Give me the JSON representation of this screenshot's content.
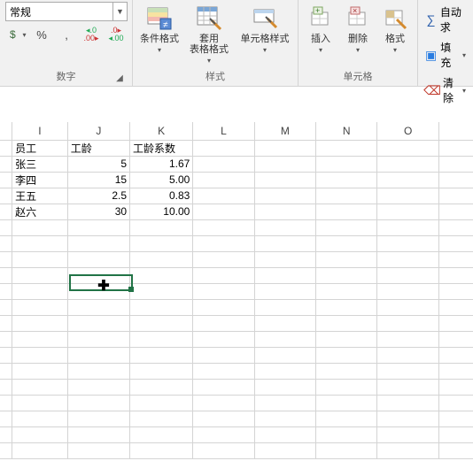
{
  "ribbon": {
    "number": {
      "group_label": "数字",
      "format_value": "常规",
      "percent": "%",
      "comma": ",",
      "inc_dec_a": ".0",
      "inc_dec_b": ".00"
    },
    "styles": {
      "group_label": "样式",
      "cond_fmt": "条件格式",
      "table_fmt": "套用\n表格格式",
      "cell_styles": "单元格样式"
    },
    "cells": {
      "group_label": "单元格",
      "insert": "插入",
      "delete": "删除",
      "format": "格式"
    },
    "editing": {
      "autosum": "自动求",
      "fill": "填充",
      "clear": "清除"
    }
  },
  "columns": [
    "I",
    "J",
    "K",
    "L",
    "M",
    "N",
    "O"
  ],
  "headers": {
    "c1": "员工",
    "c2": "工龄",
    "c3": "工龄系数"
  },
  "rows": [
    {
      "name": "张三",
      "years": "5",
      "coef": "1.67"
    },
    {
      "name": "李四",
      "years": "15",
      "coef": "5.00"
    },
    {
      "name": "王五",
      "years": "2.5",
      "coef": "0.83"
    },
    {
      "name": "赵六",
      "years": "30",
      "coef": "10.00"
    }
  ],
  "chart_data": {
    "type": "table",
    "columns": [
      "员工",
      "工龄",
      "工龄系数"
    ],
    "data": [
      [
        "张三",
        5,
        1.67
      ],
      [
        "李四",
        15,
        5.0
      ],
      [
        "王五",
        2.5,
        0.83
      ],
      [
        "赵六",
        30,
        10.0
      ]
    ]
  }
}
